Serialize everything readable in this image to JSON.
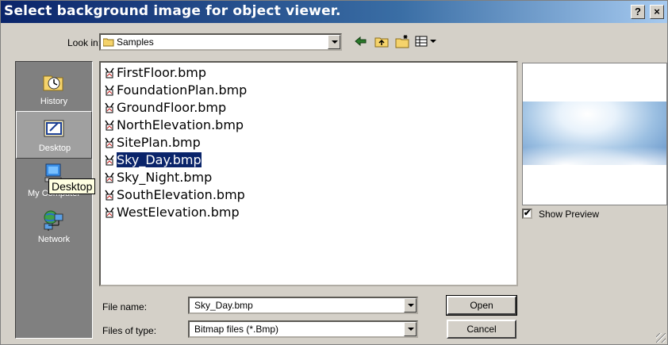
{
  "window": {
    "title": "Select background image for object viewer.",
    "help_label": "?",
    "close_label": "×"
  },
  "lookin": {
    "label": "Look in:",
    "value": "Samples"
  },
  "toolbar": {
    "back_icon": "back-arrow-icon",
    "up_icon": "up-folder-icon",
    "new_folder_icon": "new-folder-icon",
    "view_icon": "view-menu-icon"
  },
  "places": [
    {
      "label": "History",
      "icon": "history-icon"
    },
    {
      "label": "Desktop",
      "icon": "desktop-icon"
    },
    {
      "label": "My Computer",
      "icon": "computer-icon"
    },
    {
      "label": "Network",
      "icon": "network-icon"
    }
  ],
  "tooltip": "Desktop",
  "files": [
    "FirstFloor.bmp",
    "FoundationPlan.bmp",
    "GroundFloor.bmp",
    "NorthElevation.bmp",
    "SitePlan.bmp",
    "Sky_Day.bmp",
    "Sky_Night.bmp",
    "SouthElevation.bmp",
    "WestElevation.bmp"
  ],
  "selected_file": "Sky_Day.bmp",
  "preview": {
    "show_preview_label": "Show Preview",
    "checked": true,
    "check_mark": "✔"
  },
  "filename": {
    "label": "File name:",
    "value": "Sky_Day.bmp"
  },
  "filetype": {
    "label": "Files of type:",
    "value": "Bitmap files (*.Bmp)"
  },
  "buttons": {
    "open": "Open",
    "cancel": "Cancel"
  },
  "colors": {
    "title_start": "#0a246a",
    "title_end": "#a6caf0",
    "selection": "#0a246a",
    "face": "#d4d0c8"
  }
}
